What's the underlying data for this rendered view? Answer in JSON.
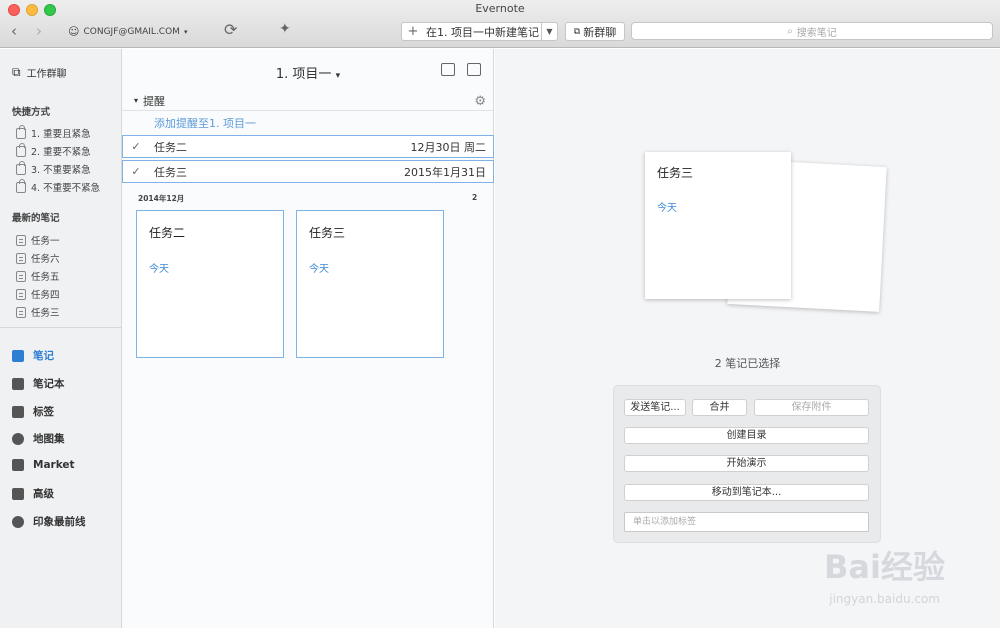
{
  "window": {
    "title": "Evernote"
  },
  "toolbar": {
    "account": "CONGJF@GMAIL.COM",
    "new_note_label": "在1. 项目一中新建笔记",
    "new_chat_label": "新群聊",
    "search_placeholder": "搜索笔记"
  },
  "sidebar": {
    "work_chat": "工作群聊",
    "shortcuts_heading": "快捷方式",
    "shortcuts": [
      "1. 重要且紧急",
      "2. 重要不紧急",
      "3. 不重要紧急",
      "4. 不重要不紧急"
    ],
    "recent_heading": "最新的笔记",
    "recent": [
      "任务一",
      "任务六",
      "任务五",
      "任务四",
      "任务三"
    ],
    "nav": [
      "笔记",
      "笔记本",
      "标签",
      "地图集",
      "Market",
      "高级",
      "印象最前线"
    ]
  },
  "notelist": {
    "notebook_title": "1. 项目一",
    "reminders_heading": "提醒",
    "add_reminder": "添加提醒至1. 项目一",
    "reminders": [
      {
        "name": "任务二",
        "date": "12月30日 周二"
      },
      {
        "name": "任务三",
        "date": "2015年1月31日"
      }
    ],
    "month_header": "2014年12月",
    "month_count": "2",
    "cards": [
      {
        "title": "任务二",
        "date": "今天"
      },
      {
        "title": "任务三",
        "date": "今天"
      }
    ]
  },
  "detail": {
    "preview_title": "任务三",
    "preview_date": "今天",
    "selected_text": "2 笔记已选择",
    "actions": {
      "send": "发送笔记...",
      "merge": "合并",
      "save_attachments": "保存附件",
      "create_toc": "创建目录",
      "present": "开始演示",
      "move": "移动到笔记本..."
    },
    "tag_placeholder": "单击以添加标签"
  },
  "watermark": {
    "brand": "Bai经验",
    "url": "jingyan.baidu.com"
  }
}
